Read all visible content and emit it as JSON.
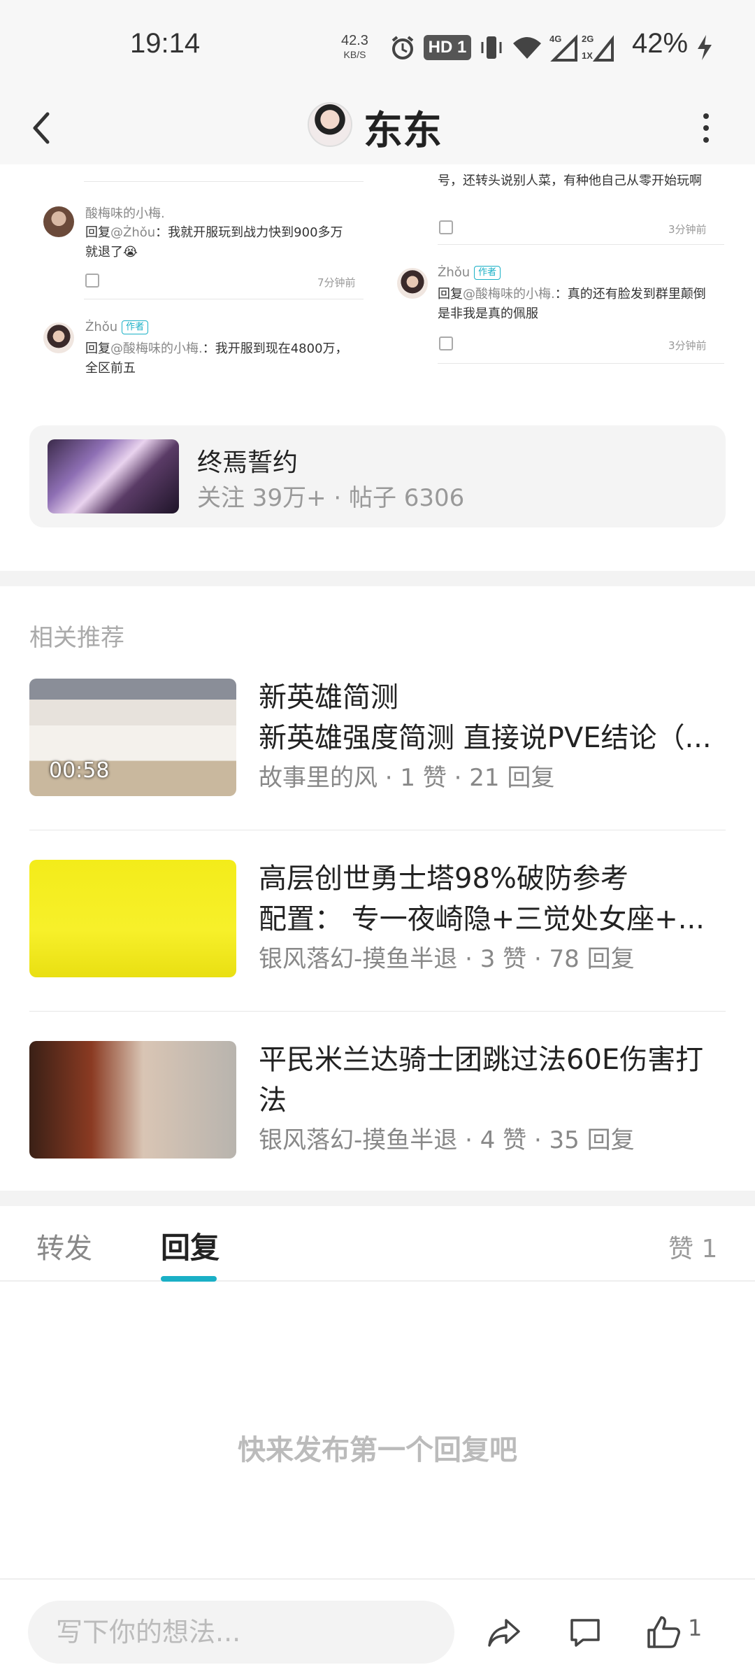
{
  "status_bar": {
    "time": "19:14",
    "net_speed": "42.3",
    "net_unit": "KB/S",
    "hd_badge": "HD 1",
    "battery": "42%"
  },
  "header": {
    "title": "东东"
  },
  "collage": {
    "left_comments": [
      {
        "name": "酸梅味的小梅.",
        "reply_prefix": "回复",
        "at": "@Żhǒu",
        "text": "：我就开服玩到战力快到900多万就退了😭",
        "time": "7分钟前"
      },
      {
        "name": "Żhǒu",
        "badge": "作者",
        "reply_prefix": "回复",
        "at": "@酸梅味的小梅.",
        "text": "：我开服到现在4800万，全区前五"
      }
    ],
    "right_comments": [
      {
        "text": "号，还转头说别人菜，有种他自己从零开始玩啊",
        "time": "3分钟前"
      },
      {
        "name": "Żhǒu",
        "badge": "作者",
        "reply_prefix": "回复",
        "at": "@酸梅味的小梅.",
        "text": "：真的还有脸发到群里颠倒是非我是真的佩服",
        "time": "3分钟前"
      }
    ]
  },
  "forum": {
    "name": "终焉誓约",
    "meta": "关注 39万+ · 帖子 6306"
  },
  "related": {
    "heading": "相关推荐",
    "items": [
      {
        "title": "新英雄简测",
        "subtitle": "新英雄强度简测 直接说PVE结论（...",
        "meta": "故事里的风 · 1 赞 · 21 回复",
        "duration": "00:58"
      },
      {
        "title": "高层创世勇士塔98%破防参考",
        "subtitle": "配置： 专一夜崎隐+三觉处女座+...",
        "meta": "银风落幻-摸鱼半退 · 3 赞 · 78 回复"
      },
      {
        "title": "平民米兰达骑士团跳过法60E伤害打",
        "subtitle": "法",
        "meta": "银风落幻-摸鱼半退 · 4 赞 · 35 回复"
      }
    ]
  },
  "tabs": {
    "forward": "转发",
    "reply": "回复",
    "like": "赞 1"
  },
  "empty_text": "快来发布第一个回复吧",
  "bottom": {
    "placeholder": "写下你的想法...",
    "like_count": "1"
  }
}
